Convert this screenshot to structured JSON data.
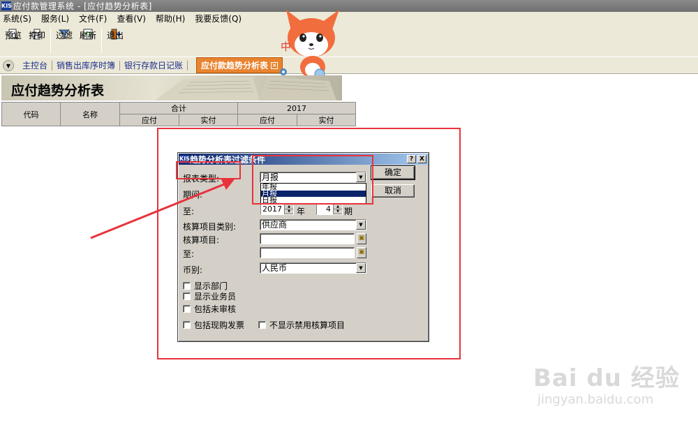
{
  "window": {
    "title": "应付款管理系统 - [应付趋势分析表]",
    "logo": "KIS"
  },
  "menubar": {
    "items": [
      "系统(S)",
      "服务(L)",
      "文件(F)",
      "查看(V)",
      "帮助(H)",
      "我要反馈(Q)"
    ]
  },
  "toolbar": {
    "preview": "预览",
    "print": "打印",
    "filter": "过滤",
    "refresh": "刷新",
    "exit": "退出"
  },
  "tabs": {
    "items": [
      "主控台",
      "销售出库序时簿",
      "银行存款日记账"
    ],
    "active": "应付款趋势分析表"
  },
  "report": {
    "title": "应付趋势分析表",
    "headers": {
      "code": "代码",
      "name": "名称",
      "total": "合计",
      "year": "2017",
      "sub": [
        "应付",
        "实付",
        "应付",
        "实付"
      ]
    }
  },
  "dialog": {
    "title": "趋势分析表过滤条件",
    "help_btn": "?",
    "close_btn": "X",
    "report_type_label": "报表类型:",
    "report_type_value": "月报",
    "report_type_options": [
      "年报",
      "月报",
      "日报"
    ],
    "period_label": "期间:",
    "to_label": "至:",
    "to_year": "2017",
    "year_unit": "年",
    "to_period": "4",
    "period_unit": "期",
    "item_category_label": "核算项目类别:",
    "item_category_value": "供应商",
    "item_label": "核算项目:",
    "item_to_label": "至:",
    "currency_label": "币别:",
    "currency_value": "人民币",
    "ok": "确定",
    "cancel": "取消",
    "checkboxes": {
      "show_dept": "显示部门",
      "show_staff": "显示业务员",
      "include_unaudited": "包括未审核",
      "include_cash_invoice": "包括现购发票",
      "hide_disabled_items": "不显示禁用核算项目"
    }
  },
  "watermark": {
    "main": "Bai du 经验",
    "sub": "jingyan.baidu.com"
  },
  "colors": {
    "annotation": "#e8323c",
    "active_tab": "#e8832e",
    "dialog_title": "#0a246a"
  }
}
